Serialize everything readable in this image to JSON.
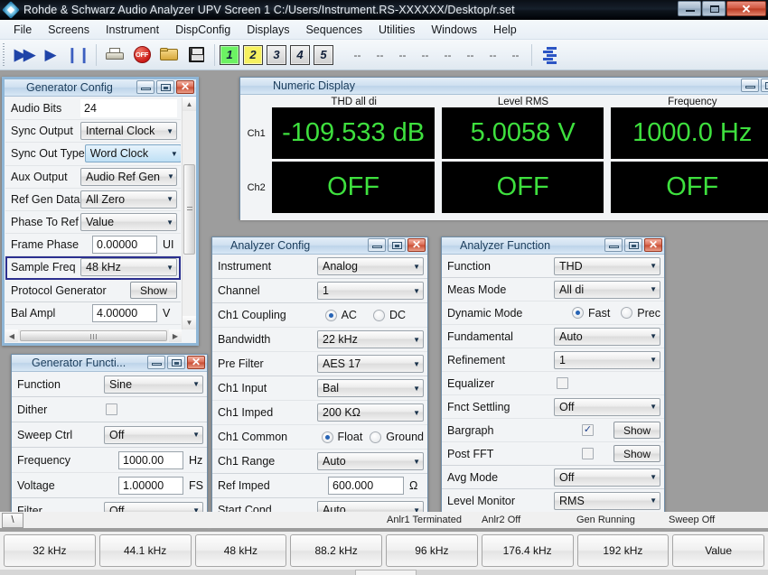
{
  "window": {
    "title": "Rohde & Schwarz Audio Analyzer UPV Screen 1 C:/Users/Instrument.RS-XXXXXX/Desktop/r.set",
    "icon": "rs-diamond-icon",
    "minimize": "–",
    "maximize": "□",
    "close": "✕"
  },
  "menu": {
    "items": [
      {
        "label": "File"
      },
      {
        "label": "Screens"
      },
      {
        "label": "Instrument"
      },
      {
        "label": "DispConfig"
      },
      {
        "label": "Displays"
      },
      {
        "label": "Sequences"
      },
      {
        "label": "Utilities"
      },
      {
        "label": "Windows"
      },
      {
        "label": "Help"
      }
    ]
  },
  "toolbar": {
    "buttons": [
      {
        "name": "fast-forward-icon",
        "glyph": "▶▶"
      },
      {
        "name": "play-icon",
        "glyph": "▶"
      },
      {
        "name": "pause-icon",
        "glyph": "❙❙"
      },
      {
        "name": "print-icon",
        "glyph": ""
      },
      {
        "name": "stop-off-icon",
        "glyph": "OFF"
      },
      {
        "name": "open-folder-icon",
        "glyph": ""
      },
      {
        "name": "save-disk-icon",
        "glyph": ""
      }
    ],
    "screen_buttons": [
      {
        "label": "1",
        "state": "green"
      },
      {
        "label": "2",
        "state": "yellow"
      },
      {
        "label": "3",
        "state": "gray"
      },
      {
        "label": "4",
        "state": "gray"
      },
      {
        "label": "5",
        "state": "gray"
      }
    ],
    "dashes": [
      "--",
      "--",
      "--",
      "--",
      "--",
      "--",
      "--",
      "--"
    ],
    "sequence_icon": "sequence-icon"
  },
  "numeric_display": {
    "title": "Numeric Display",
    "columns": [
      "THD all di",
      "Level RMS",
      "Frequency"
    ],
    "rows": [
      {
        "channel": "Ch1",
        "values": [
          "-109.533 dB",
          "5.0058 V",
          "1000.0 Hz"
        ]
      },
      {
        "channel": "Ch2",
        "values": [
          "OFF",
          "OFF",
          "OFF"
        ]
      }
    ],
    "value_color": "#3ee03e",
    "background_color": "#000000"
  },
  "generator_config": {
    "title": "Generator Config",
    "rows": [
      {
        "label": "Audio Bits",
        "type": "text",
        "value": "24",
        "unit": ""
      },
      {
        "label": "Sync Output",
        "type": "combo",
        "value": "Internal Clock"
      },
      {
        "label": "Sync Out Type",
        "type": "combo",
        "value": "Word Clock",
        "highlight": true
      },
      {
        "label": "Aux Output",
        "type": "combo",
        "value": "Audio Ref Gen"
      },
      {
        "label": "Ref Gen Data",
        "type": "combo",
        "value": "All Zero"
      },
      {
        "label": "Phase To Ref",
        "type": "combo",
        "value": "Value"
      },
      {
        "label": "Frame Phase",
        "type": "text",
        "value": "0.00000",
        "unit": "UI"
      },
      {
        "label": "Sample Freq",
        "type": "combo",
        "value": "48 kHz",
        "selected": true
      },
      {
        "label": "Protocol Generator",
        "type": "button",
        "value": "Show"
      },
      {
        "label": "Bal Ampl",
        "type": "text",
        "value": "4.00000",
        "unit": "V"
      }
    ]
  },
  "generator_function": {
    "title": "Generator Functi...",
    "rows": [
      {
        "label": "Function",
        "type": "combo",
        "value": "Sine"
      },
      {
        "label": "Dither",
        "type": "checkbox",
        "checked": false
      },
      {
        "label": "Sweep Ctrl",
        "type": "combo",
        "value": "Off"
      },
      {
        "label": "Frequency",
        "type": "text",
        "value": "1000.00",
        "unit": "Hz"
      },
      {
        "label": "Voltage",
        "type": "text",
        "value": "1.00000",
        "unit": "FS"
      },
      {
        "label": "Filter",
        "type": "combo",
        "value": "Off"
      }
    ]
  },
  "analyzer_config": {
    "title": "Analyzer Config",
    "rows": [
      {
        "label": "Instrument",
        "type": "combo",
        "value": "Analog"
      },
      {
        "label": "Channel",
        "type": "combo",
        "value": "1"
      },
      {
        "label": "Ch1 Coupling",
        "type": "radio",
        "options": [
          "AC",
          "DC"
        ],
        "selected": "AC"
      },
      {
        "label": "Bandwidth",
        "type": "combo",
        "value": "22 kHz"
      },
      {
        "label": "Pre Filter",
        "type": "combo",
        "value": "AES 17"
      },
      {
        "label": "Ch1 Input",
        "type": "combo",
        "value": "Bal"
      },
      {
        "label": "Ch1 Imped",
        "type": "combo",
        "value": "200 KΩ"
      },
      {
        "label": "Ch1 Common",
        "type": "radio",
        "options": [
          "Float",
          "Ground"
        ],
        "selected": "Float"
      },
      {
        "label": "Ch1 Range",
        "type": "combo",
        "value": "Auto"
      },
      {
        "label": "Ref Imped",
        "type": "text",
        "value": "600.000",
        "unit": "Ω"
      },
      {
        "label": "Start Cond",
        "type": "combo",
        "value": "Auto"
      }
    ]
  },
  "analyzer_function": {
    "title": "Analyzer Function",
    "rows": [
      {
        "label": "Function",
        "type": "combo",
        "value": "THD"
      },
      {
        "label": "Meas Mode",
        "type": "combo",
        "value": "All di"
      },
      {
        "label": "Dynamic Mode",
        "type": "radio",
        "options": [
          "Fast",
          "Prec"
        ],
        "selected": "Fast"
      },
      {
        "label": "Fundamental",
        "type": "combo",
        "value": "Auto"
      },
      {
        "label": "Refinement",
        "type": "combo",
        "value": "1"
      },
      {
        "label": "Equalizer",
        "type": "checkbox",
        "checked": false
      },
      {
        "label": "Fnct Settling",
        "type": "combo",
        "value": "Off"
      },
      {
        "label": "Bargraph",
        "type": "checkbox",
        "checked": true,
        "button": "Show"
      },
      {
        "label": "Post FFT",
        "type": "checkbox",
        "checked": false,
        "button": "Show"
      },
      {
        "label": "Avg Mode",
        "type": "combo",
        "value": "Off"
      },
      {
        "label": "Level Monitor",
        "type": "combo",
        "value": "RMS"
      }
    ]
  },
  "statusbar": {
    "left_indicator": "\\",
    "items": [
      "Anlr1 Terminated",
      "Anlr2 Off",
      "Gen Running",
      "Sweep Off"
    ]
  },
  "softkeys": [
    {
      "label": "32 kHz"
    },
    {
      "label": "44.1 kHz"
    },
    {
      "label": "48 kHz"
    },
    {
      "label": "88.2 kHz"
    },
    {
      "label": "96 kHz"
    },
    {
      "label": "176.4 kHz"
    },
    {
      "label": "192 kHz"
    },
    {
      "label": "Value"
    }
  ]
}
